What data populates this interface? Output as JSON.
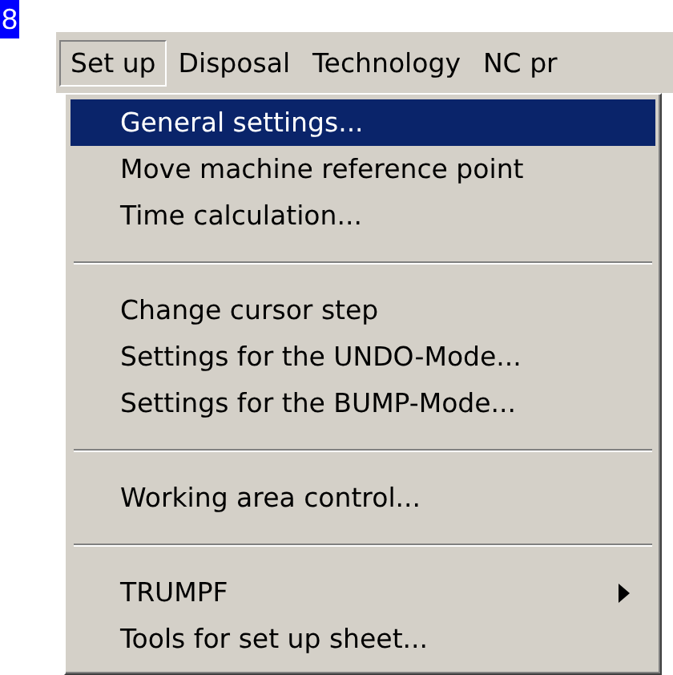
{
  "step_badge": "8",
  "menubar": [
    {
      "label": "Set up",
      "selected": true
    },
    {
      "label": "Disposal",
      "selected": false
    },
    {
      "label": "Technology",
      "selected": false
    },
    {
      "label": "NC pr",
      "selected": false
    }
  ],
  "menu": [
    {
      "kind": "item",
      "label": "General settings...",
      "selected": true,
      "submenu": false
    },
    {
      "kind": "item",
      "label": "Move machine reference point",
      "selected": false,
      "submenu": false
    },
    {
      "kind": "item",
      "label": "Time calculation...",
      "selected": false,
      "submenu": false
    },
    {
      "kind": "separator"
    },
    {
      "kind": "item",
      "label": "Change cursor step",
      "selected": false,
      "submenu": false
    },
    {
      "kind": "item",
      "label": "Settings for the UNDO-Mode...",
      "selected": false,
      "submenu": false
    },
    {
      "kind": "item",
      "label": "Settings for the BUMP-Mode...",
      "selected": false,
      "submenu": false
    },
    {
      "kind": "separator"
    },
    {
      "kind": "item",
      "label": "Working area control...",
      "selected": false,
      "submenu": false
    },
    {
      "kind": "separator"
    },
    {
      "kind": "item",
      "label": "TRUMPF",
      "selected": false,
      "submenu": true
    },
    {
      "kind": "item",
      "label": "Tools for set up sheet...",
      "selected": false,
      "submenu": false
    }
  ]
}
